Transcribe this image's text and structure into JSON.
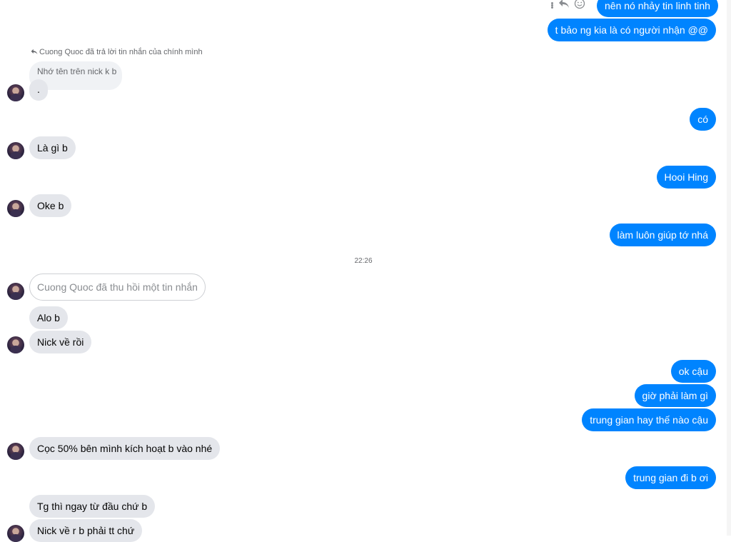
{
  "toolbar": {
    "more_icon": "more-vertical-icon",
    "reply_icon": "reply-icon",
    "react_icon": "smiley-icon"
  },
  "reply_context": {
    "note": "Cuong Quoc đã trả lời tin nhắn của chính mình",
    "quoted": "Nhớ tên trên nick k b"
  },
  "timestamp": "22:26",
  "recalled_text": "Cuong Quoc đã thu hồi một tin nhắn",
  "messages": {
    "out_1": "nên nó nhảy tin linh tinh",
    "out_2": "t bảo ng kia là có người nhận @@",
    "in_dot": ".",
    "out_co": "có",
    "in_la_gi": "Là gì b",
    "out_hooi": "Hooi Hing",
    "in_oke": "Oke b",
    "out_lam_luon": "làm luôn giúp tớ nhá",
    "in_alo": "Alo b",
    "in_nick_ve": "Nick về rồi",
    "out_ok_cau": "ok cậu",
    "out_gio_phai": "giờ phải làm gì",
    "out_trung_gian_hay": "trung gian hay thế nào cậu",
    "in_coc": "Cọc 50% bên mình kích hoạt b vào nhé",
    "out_trung_gian_di": "trung gian đi b ơi",
    "in_tg_thi": "Tg thì ngay từ đầu chứ b",
    "in_nick_ve_r": "Nick về r b phải tt chứ"
  },
  "colors": {
    "outgoing_bubble": "#0084ff",
    "incoming_bubble": "#e4e6eb",
    "quoted_bubble": "#f0f2f5"
  }
}
